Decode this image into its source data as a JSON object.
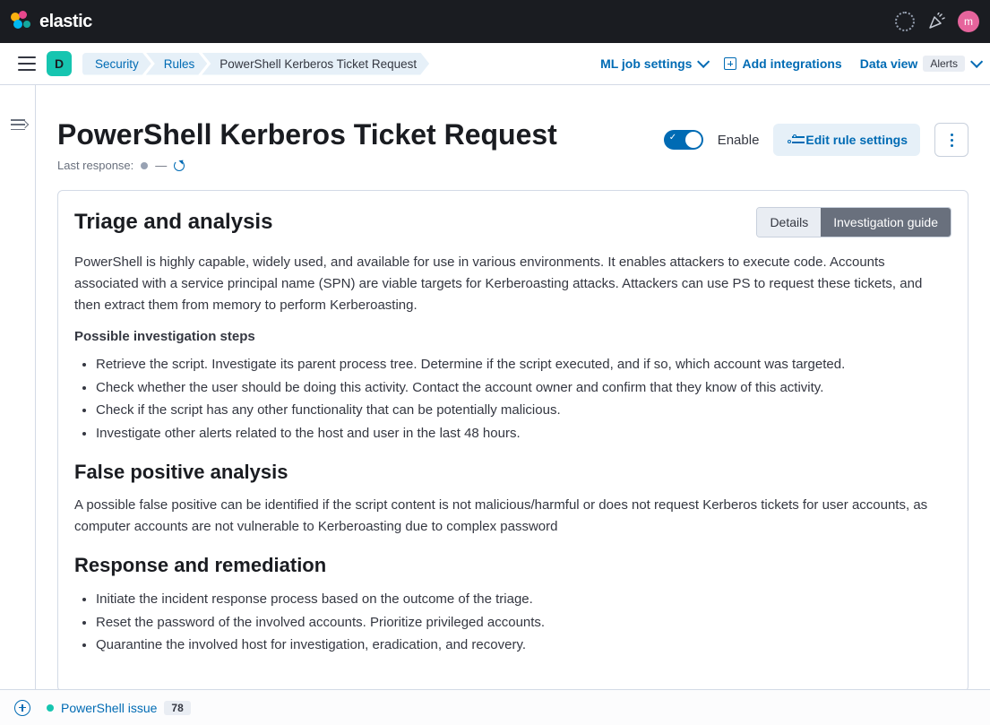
{
  "header": {
    "brand": "elastic",
    "avatar_initial": "m"
  },
  "subheader": {
    "space_initial": "D",
    "breadcrumbs": [
      "Security",
      "Rules",
      "PowerShell Kerberos Ticket Request"
    ],
    "ml_link": "ML job settings",
    "add_integrations": "Add integrations",
    "data_view": "Data view",
    "alerts_badge": "Alerts"
  },
  "title": {
    "text": "PowerShell Kerberos Ticket Request",
    "last_response_label": "Last response:",
    "dash": "—"
  },
  "actions": {
    "enable_label": "Enable",
    "edit_button": "Edit rule settings"
  },
  "tabs": {
    "details": "Details",
    "investigation": "Investigation guide"
  },
  "guide": {
    "triage_heading": "Triage and analysis",
    "intro": "PowerShell is highly capable, widely used, and available for use in various environments. It enables attackers to execute code. Accounts associated with a service principal name (SPN) are viable targets for Kerberoasting attacks. Attackers can use PS to request these tickets, and then extract them from memory to perform Kerberoasting.",
    "steps_heading": "Possible investigation steps",
    "steps": [
      "Retrieve the script. Investigate its parent process tree. Determine if the script executed, and if so, which account was targeted.",
      "Check whether the user should be doing this activity. Contact the account owner and confirm that they know of this activity.",
      "Check if the script has any other functionality that can be potentially malicious.",
      "Investigate other alerts related to the host and user in the last 48 hours."
    ],
    "fp_heading": "False positive analysis",
    "fp_text": "A possible false positive can be identified if the script content is not malicious/harmful or does not request Kerberos tickets for user accounts, as computer accounts are not vulnerable to Kerberoasting due to complex password",
    "rr_heading": "Response and remediation",
    "rr_steps": [
      "Initiate the incident response process based on the outcome of the triage.",
      "Reset the password of the involved accounts. Prioritize privileged accounts.",
      "Quarantine the involved host for investigation, eradication, and recovery."
    ]
  },
  "bottom": {
    "timeline_name": "PowerShell issue",
    "count": "78"
  }
}
